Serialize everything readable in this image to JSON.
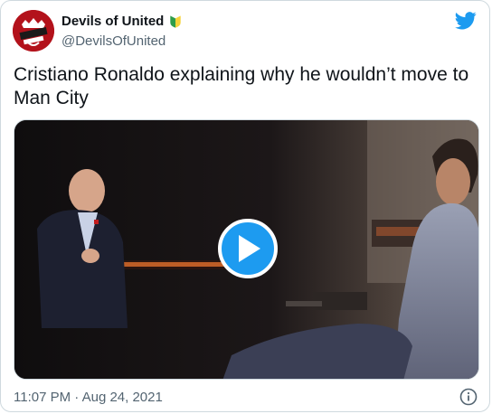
{
  "author": {
    "display_name": "Devils of United",
    "handle": "@DevilsOfUnited",
    "avatar_icon": "devils-of-united-crest",
    "badge_icon": "beginner-shield-icon"
  },
  "tweet": {
    "text": "Cristiano Ronaldo explaining why he wouldn’t move to Man City",
    "timestamp": "11:07 PM · Aug 24, 2021"
  },
  "media": {
    "type": "video",
    "play_icon": "play-icon"
  },
  "colors": {
    "accent": "#1d9bf0",
    "text": "#0f1419",
    "muted": "#536471",
    "border": "#cfd9de",
    "avatar_red": "#b3121b"
  },
  "icons": {
    "brand": "twitter-bird-icon",
    "info": "info-icon"
  }
}
